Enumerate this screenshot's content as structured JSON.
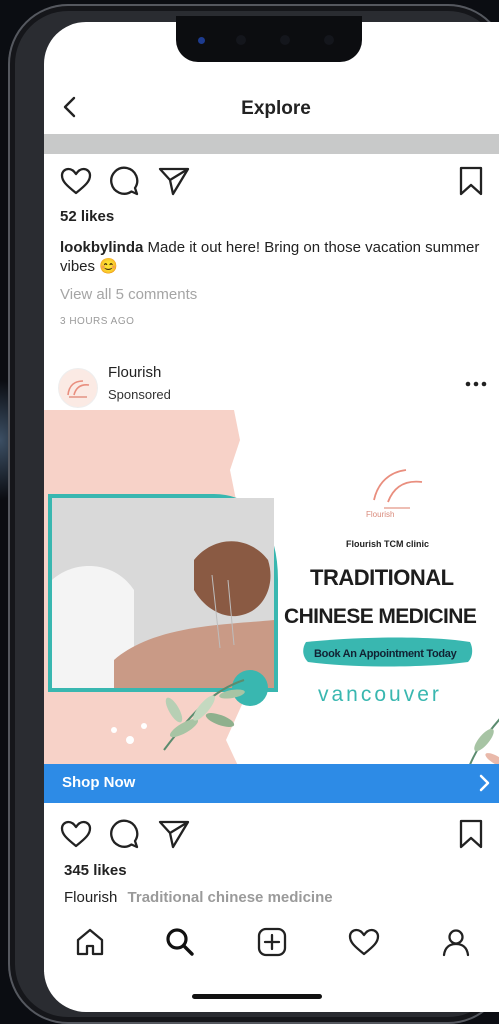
{
  "header": {
    "title": "Explore"
  },
  "post1": {
    "likes": "52 likes",
    "username": "lookbylinda",
    "caption": "Made it out here! Bring on those vacation summer vibes",
    "emoji": "😊",
    "comments_link": "View all 5 comments",
    "timestamp": "3 HOURS AGO"
  },
  "ad_post": {
    "account": "Flourish",
    "label": "Sponsored",
    "creative": {
      "clinic_name": "Flourish TCM clinic",
      "headline_line1": "TRADITIONAL",
      "headline_line2": "CHINESE MEDICINE",
      "cta_badge": "Book An Appointment Today",
      "city": "vancouver",
      "logo_text": "Flourish"
    },
    "shop_button": "Shop Now",
    "likes": "345 likes",
    "caption_user": "Flourish",
    "caption_text": "Traditional chinese medicine"
  },
  "colors": {
    "accent_blue": "#2d8be6",
    "teal": "#39b7b0",
    "peach": "#f7d2c8"
  },
  "icons": {
    "back": "chevron-left-icon",
    "like": "heart-icon",
    "comment": "comment-icon",
    "share": "paper-plane-icon",
    "save": "bookmark-icon",
    "more": "more-dots-icon",
    "shop_chevron": "chevron-right-icon",
    "tab_home": "home-icon",
    "tab_search": "search-icon",
    "tab_add": "add-post-icon",
    "tab_activity": "heart-icon",
    "tab_profile": "profile-icon"
  }
}
